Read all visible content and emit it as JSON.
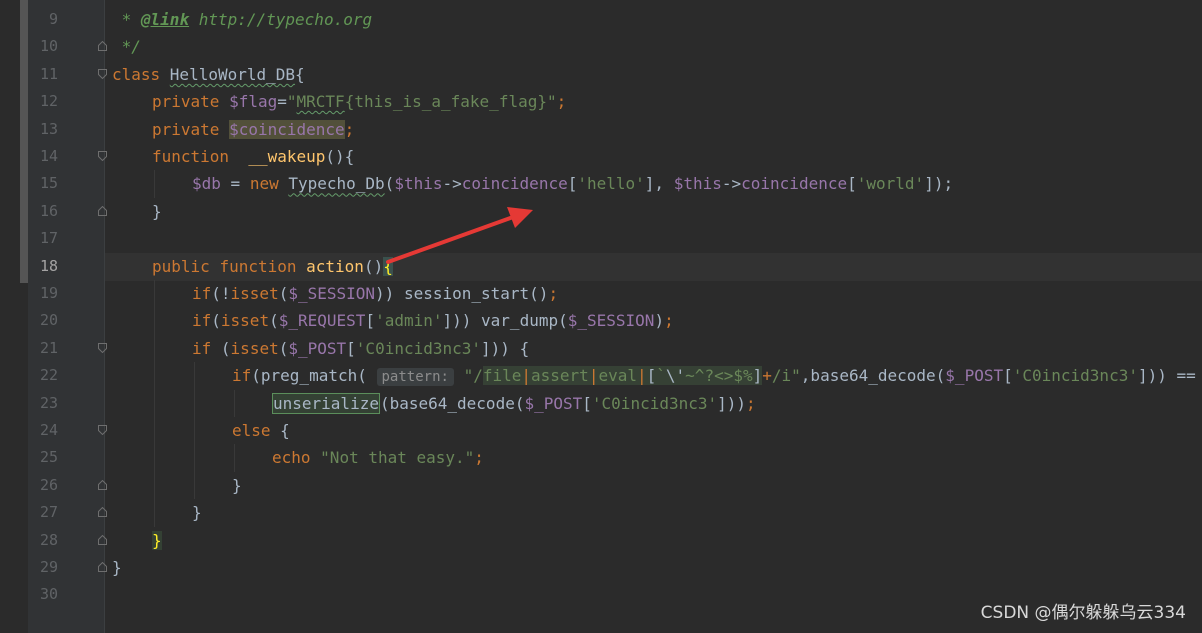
{
  "editor": {
    "language": "php",
    "current_line": 18,
    "colors": {
      "background": "#2b2b2b",
      "gutter": "#313335",
      "keyword": "#cc7832",
      "string": "#6a8759",
      "variable": "#9876aa",
      "function": "#ffc66d",
      "comment": "#629755",
      "plain": "#a9b7c6",
      "annotation_arrow": "#e53935"
    },
    "lines": [
      {
        "n": "9",
        "indent": 0,
        "fold": "",
        "tokens": [
          {
            "t": " * ",
            "c": "cmt"
          },
          {
            "t": "@link",
            "c": "doctag"
          },
          {
            "t": " http://typecho.org",
            "c": "cmt"
          }
        ]
      },
      {
        "n": "10",
        "indent": 0,
        "fold": "end",
        "tokens": [
          {
            "t": " */",
            "c": "cmt"
          }
        ]
      },
      {
        "n": "11",
        "indent": 0,
        "fold": "start",
        "tokens": [
          {
            "t": "class ",
            "c": "kw"
          },
          {
            "t": "HelloWorld_DB",
            "c": "plain typo"
          },
          {
            "t": "{",
            "c": "plain"
          }
        ]
      },
      {
        "n": "12",
        "indent": 1,
        "fold": "",
        "tokens": [
          {
            "t": "private ",
            "c": "kw"
          },
          {
            "t": "$flag",
            "c": "var"
          },
          {
            "t": "=",
            "c": "plain"
          },
          {
            "t": "\"",
            "c": "str"
          },
          {
            "t": "MRCTF",
            "c": "str typo"
          },
          {
            "t": "{this_is_a_fake_flag}\"",
            "c": "str"
          },
          {
            "t": ";",
            "c": "kw"
          }
        ]
      },
      {
        "n": "13",
        "indent": 1,
        "fold": "",
        "tokens": [
          {
            "t": "private ",
            "c": "kw"
          },
          {
            "t": "$coincidence",
            "c": "var hl-var"
          },
          {
            "t": ";",
            "c": "kw"
          }
        ]
      },
      {
        "n": "14",
        "indent": 1,
        "fold": "start",
        "tokens": [
          {
            "t": "function  ",
            "c": "kw"
          },
          {
            "t": "__wakeup",
            "c": "fn"
          },
          {
            "t": "(){",
            "c": "plain"
          }
        ]
      },
      {
        "n": "15",
        "indent": 2,
        "fold": "",
        "tokens": [
          {
            "t": "$db",
            "c": "var"
          },
          {
            "t": " = ",
            "c": "plain"
          },
          {
            "t": "new ",
            "c": "kw"
          },
          {
            "t": "Typecho_Db",
            "c": "plain typo"
          },
          {
            "t": "(",
            "c": "plain"
          },
          {
            "t": "$this",
            "c": "var"
          },
          {
            "t": "->",
            "c": "plain"
          },
          {
            "t": "coincidence",
            "c": "var"
          },
          {
            "t": "[",
            "c": "plain"
          },
          {
            "t": "'hello'",
            "c": "str"
          },
          {
            "t": "], ",
            "c": "plain"
          },
          {
            "t": "$this",
            "c": "var"
          },
          {
            "t": "->",
            "c": "plain"
          },
          {
            "t": "coincidence",
            "c": "var"
          },
          {
            "t": "[",
            "c": "plain"
          },
          {
            "t": "'world'",
            "c": "str"
          },
          {
            "t": "]);",
            "c": "plain"
          }
        ]
      },
      {
        "n": "16",
        "indent": 1,
        "fold": "end",
        "tokens": [
          {
            "t": "}",
            "c": "plain"
          }
        ]
      },
      {
        "n": "17",
        "indent": 0,
        "fold": "",
        "tokens": []
      },
      {
        "n": "18",
        "indent": 1,
        "fold": "",
        "tokens": [
          {
            "t": "public ",
            "c": "kw"
          },
          {
            "t": "function ",
            "c": "kw"
          },
          {
            "t": "action",
            "c": "fn"
          },
          {
            "t": "()",
            "c": "plain"
          },
          {
            "t": "{",
            "c": "brace-match"
          }
        ]
      },
      {
        "n": "19",
        "indent": 2,
        "fold": "",
        "tokens": [
          {
            "t": "if",
            "c": "kw"
          },
          {
            "t": "(!",
            "c": "plain"
          },
          {
            "t": "isset",
            "c": "kw"
          },
          {
            "t": "(",
            "c": "plain"
          },
          {
            "t": "$_SESSION",
            "c": "var"
          },
          {
            "t": ")) session_start()",
            "c": "plain"
          },
          {
            "t": ";",
            "c": "kw"
          }
        ]
      },
      {
        "n": "20",
        "indent": 2,
        "fold": "",
        "tokens": [
          {
            "t": "if",
            "c": "kw"
          },
          {
            "t": "(",
            "c": "plain"
          },
          {
            "t": "isset",
            "c": "kw"
          },
          {
            "t": "(",
            "c": "plain"
          },
          {
            "t": "$_REQUEST",
            "c": "var"
          },
          {
            "t": "[",
            "c": "plain"
          },
          {
            "t": "'admin'",
            "c": "str"
          },
          {
            "t": "])) var_dump(",
            "c": "plain"
          },
          {
            "t": "$_SESSION",
            "c": "var"
          },
          {
            "t": ")",
            "c": "plain"
          },
          {
            "t": ";",
            "c": "kw"
          }
        ]
      },
      {
        "n": "21",
        "indent": 2,
        "fold": "start",
        "tokens": [
          {
            "t": "if ",
            "c": "kw"
          },
          {
            "t": "(",
            "c": "plain"
          },
          {
            "t": "isset",
            "c": "kw"
          },
          {
            "t": "(",
            "c": "plain"
          },
          {
            "t": "$_POST",
            "c": "var"
          },
          {
            "t": "[",
            "c": "plain"
          },
          {
            "t": "'C0incid3nc3'",
            "c": "str"
          },
          {
            "t": "])) {",
            "c": "plain"
          }
        ]
      },
      {
        "n": "22",
        "indent": 3,
        "fold": "",
        "tokens": [
          {
            "t": "if",
            "c": "kw"
          },
          {
            "t": "(preg_match( ",
            "c": "plain"
          },
          {
            "t": "pattern:",
            "c": "hint"
          },
          {
            "t": " \"/",
            "c": "str"
          },
          {
            "t": "file",
            "c": "str regex-bg"
          },
          {
            "t": "|",
            "c": "regex-op regex-bg"
          },
          {
            "t": "assert",
            "c": "str regex-bg"
          },
          {
            "t": "|",
            "c": "regex-op regex-bg"
          },
          {
            "t": "eval",
            "c": "str regex-bg"
          },
          {
            "t": "|",
            "c": "regex-op regex-bg"
          },
          {
            "t": "[",
            "c": "plain regex-bg"
          },
          {
            "t": "`",
            "c": "str regex-bg"
          },
          {
            "t": "\\'",
            "c": "plain regex-bg"
          },
          {
            "t": "~^?<>$%",
            "c": "str regex-bg"
          },
          {
            "t": "]",
            "c": "plain regex-bg"
          },
          {
            "t": "+",
            "c": "regex-op"
          },
          {
            "t": "/i\"",
            "c": "str"
          },
          {
            "t": ",base64_decode(",
            "c": "plain"
          },
          {
            "t": "$_POST",
            "c": "var"
          },
          {
            "t": "[",
            "c": "plain"
          },
          {
            "t": "'C0incid3nc3'",
            "c": "str"
          },
          {
            "t": "])) ==",
            "c": "plain"
          }
        ]
      },
      {
        "n": "23",
        "indent": 4,
        "fold": "",
        "tokens": [
          {
            "t": "unserialize",
            "c": "plain hl-usage"
          },
          {
            "t": "(base64_decode(",
            "c": "plain"
          },
          {
            "t": "$_POST",
            "c": "var"
          },
          {
            "t": "[",
            "c": "plain"
          },
          {
            "t": "'C0incid3nc3'",
            "c": "str"
          },
          {
            "t": "]))",
            "c": "plain"
          },
          {
            "t": ";",
            "c": "kw"
          }
        ]
      },
      {
        "n": "24",
        "indent": 3,
        "fold": "start",
        "tokens": [
          {
            "t": "else ",
            "c": "kw"
          },
          {
            "t": "{",
            "c": "plain"
          }
        ]
      },
      {
        "n": "25",
        "indent": 4,
        "fold": "",
        "tokens": [
          {
            "t": "echo ",
            "c": "kw"
          },
          {
            "t": "\"Not that easy.\"",
            "c": "str"
          },
          {
            "t": ";",
            "c": "kw"
          }
        ]
      },
      {
        "n": "26",
        "indent": 3,
        "fold": "end",
        "tokens": [
          {
            "t": "}",
            "c": "plain"
          }
        ]
      },
      {
        "n": "27",
        "indent": 2,
        "fold": "end",
        "tokens": [
          {
            "t": "}",
            "c": "plain"
          }
        ]
      },
      {
        "n": "28",
        "indent": 1,
        "fold": "end",
        "tokens": [
          {
            "t": "}",
            "c": "brace-hl"
          }
        ]
      },
      {
        "n": "29",
        "indent": 0,
        "fold": "end",
        "tokens": [
          {
            "t": "}",
            "c": "plain"
          }
        ]
      },
      {
        "n": "30",
        "indent": 0,
        "fold": "",
        "tokens": []
      }
    ]
  },
  "watermark": "CSDN @偶尔躲躲乌云334"
}
